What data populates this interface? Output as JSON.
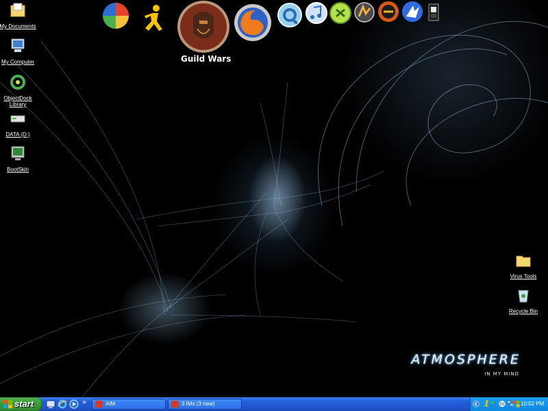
{
  "desktop_icons_left": [
    {
      "name": "my-documents-icon",
      "label": "My Documents"
    },
    {
      "name": "my-computer-icon",
      "label": "My Computer"
    },
    {
      "name": "objectdock-library-icon",
      "label": "ObjectDock Library"
    },
    {
      "name": "data-drive-icon",
      "label": "DATA (D:)"
    },
    {
      "name": "bootskin-icon",
      "label": "BootSkin"
    }
  ],
  "desktop_icons_right": [
    {
      "name": "virus-tools-folder-icon",
      "label": "Virus Tools"
    },
    {
      "name": "recycle-bin-icon",
      "label": "Recycle Bin"
    }
  ],
  "dock": {
    "hover_label": "Guild Wars",
    "icons": [
      "windows-media-icon",
      "aim-running-man-icon",
      "guild-wars-icon",
      "firefox-icon",
      "quicktime-icon",
      "itunes-icon",
      "nero-icon",
      "winamp-icon",
      "music-app-icon",
      "app-icon",
      "trash-icon"
    ]
  },
  "wallpaper": {
    "title": "ATMOSPHERE",
    "subtitle": "IN MY MIND"
  },
  "taskbar": {
    "start_label": "start",
    "quick_launch": [
      "show-desktop-icon",
      "internet-explorer-icon",
      "windows-media-player-icon"
    ],
    "overflow": "»",
    "tasks": [
      {
        "label": "AIM",
        "color": "#d43a2c"
      },
      {
        "label": "3 IMs (3 new)",
        "color": "#d43a2c"
      }
    ],
    "tray_icons": [
      "tray-expand-icon",
      "aim-tray-icon",
      "msn-tray-icon",
      "word-tray-icon",
      "network-tray-icon",
      "windows-tray-icon"
    ],
    "clock": "10:02 PM"
  },
  "colors": {
    "taskbar": "#245edb",
    "start_button": "#3a9a3a",
    "tray": "#0e8ae0"
  }
}
